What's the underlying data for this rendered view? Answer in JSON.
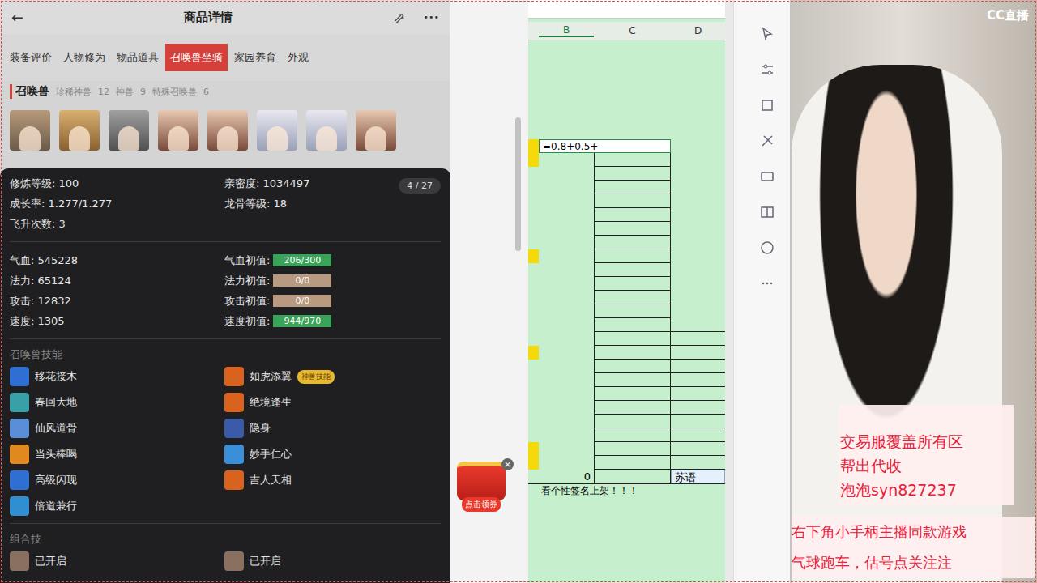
{
  "header": {
    "back": "←",
    "title": "商品详情",
    "share": "⇗",
    "more": "•••"
  },
  "tabs": [
    {
      "label": "装备评价",
      "selected": false
    },
    {
      "label": "人物修为",
      "selected": false
    },
    {
      "label": "物品道具",
      "selected": false
    },
    {
      "label": "召唤兽坐骑",
      "selected": true
    },
    {
      "label": "家园养育",
      "selected": false
    },
    {
      "label": "外观",
      "selected": false
    }
  ],
  "section": {
    "title": "召唤兽",
    "counts": [
      {
        "label": "珍稀神兽",
        "value": "12"
      },
      {
        "label": "神兽",
        "value": "9"
      },
      {
        "label": "特殊召唤兽",
        "value": "6"
      }
    ]
  },
  "pet": {
    "page": "4 / 27",
    "info": [
      {
        "label": "修炼等级:",
        "value": "100"
      },
      {
        "label": "亲密度:",
        "value": "1034497"
      },
      {
        "label": "成长率:",
        "value": "1.277/1.277"
      },
      {
        "label": "龙骨等级:",
        "value": "18"
      },
      {
        "label": "飞升次数:",
        "value": "3"
      }
    ],
    "stats": [
      {
        "label": "气血:",
        "value": "545228",
        "base_label": "气血初值:",
        "base": "206/300",
        "level": 1
      },
      {
        "label": "法力:",
        "value": "65124",
        "base_label": "法力初值:",
        "base": "0/0",
        "level": 0
      },
      {
        "label": "攻击:",
        "value": "12832",
        "base_label": "攻击初值:",
        "base": "0/0",
        "level": 0
      },
      {
        "label": "速度:",
        "value": "1305",
        "base_label": "速度初值:",
        "base": "944/970",
        "level": 1
      }
    ],
    "skills_title": "召唤兽技能",
    "skills": [
      {
        "name": "移花接木",
        "color": "#2f6fd1",
        "badge": ""
      },
      {
        "name": "如虎添翼",
        "color": "#d9631e",
        "badge": "神兽技能"
      },
      {
        "name": "春回大地",
        "color": "#3aa0a8",
        "badge": ""
      },
      {
        "name": "绝境逢生",
        "color": "#d9631e",
        "badge": ""
      },
      {
        "name": "仙风道骨",
        "color": "#5a8fd8",
        "badge": ""
      },
      {
        "name": "隐身",
        "color": "#3b5aa8",
        "badge": ""
      },
      {
        "name": "当头棒喝",
        "color": "#e0891e",
        "badge": ""
      },
      {
        "name": "妙手仁心",
        "color": "#3a8fd8",
        "badge": ""
      },
      {
        "name": "高级闪现",
        "color": "#2f6fd1",
        "badge": ""
      },
      {
        "name": "吉人天相",
        "color": "#d9631e",
        "badge": ""
      },
      {
        "name": "倍道兼行",
        "color": "#2f8fd1",
        "badge": ""
      }
    ],
    "combo_title": "组合技",
    "combos": [
      "已开启",
      "已开启"
    ]
  },
  "coupon": {
    "label": "点击领券",
    "close": "×"
  },
  "sheet": {
    "columns": [
      "B",
      "C",
      "D"
    ],
    "rows": [
      {
        "b": "=0.8+0.5+",
        "d": "",
        "marked": true,
        "editing": true
      },
      {
        "b": "",
        "d": "",
        "marked": true,
        "editing": false
      },
      {
        "b": "",
        "d": "",
        "marked": false,
        "editing": false
      },
      {
        "b": "",
        "d": "",
        "marked": false,
        "editing": false
      },
      {
        "b": "",
        "d": "",
        "marked": false,
        "editing": false
      },
      {
        "b": "",
        "d": "",
        "marked": false,
        "editing": false
      },
      {
        "b": "",
        "d": "",
        "marked": false,
        "editing": false
      },
      {
        "b": "",
        "d": "",
        "marked": false,
        "editing": false
      },
      {
        "b": "",
        "d": "",
        "marked": true,
        "editing": false
      },
      {
        "b": "",
        "d": "",
        "marked": false,
        "editing": false
      },
      {
        "b": "",
        "d": "",
        "marked": false,
        "editing": false
      },
      {
        "b": "",
        "d": "",
        "marked": false,
        "editing": false
      },
      {
        "b": "",
        "d": "",
        "marked": false,
        "editing": false
      },
      {
        "b": "",
        "d": "",
        "marked": false,
        "editing": false
      },
      {
        "b": "",
        "d": "",
        "marked": false,
        "editing": false
      },
      {
        "b": "",
        "d": "",
        "marked": true,
        "editing": false
      },
      {
        "b": "",
        "d": "",
        "marked": false,
        "editing": false
      },
      {
        "b": "",
        "d": "",
        "marked": false,
        "editing": false
      },
      {
        "b": "",
        "d": "",
        "marked": false,
        "editing": false
      },
      {
        "b": "",
        "d": "",
        "marked": false,
        "editing": false
      },
      {
        "b": "",
        "d": "",
        "marked": false,
        "editing": false
      },
      {
        "b": "",
        "d": "",
        "marked": false,
        "editing": false
      },
      {
        "b": "",
        "d": "",
        "marked": true,
        "editing": false
      },
      {
        "b": "",
        "d": "",
        "marked": true,
        "editing": false
      },
      {
        "b": "0",
        "d": "苏语",
        "marked": false,
        "editing": false
      }
    ],
    "note": "看个性签名上架！！！"
  },
  "stream": {
    "logo": "CC直播",
    "box": [
      "交易服覆盖所有区",
      "帮出代收",
      "泡泡syn827237"
    ],
    "banner": [
      "右下角小手柄主播同款游戏",
      "气球跑车，估号点关注注"
    ]
  }
}
